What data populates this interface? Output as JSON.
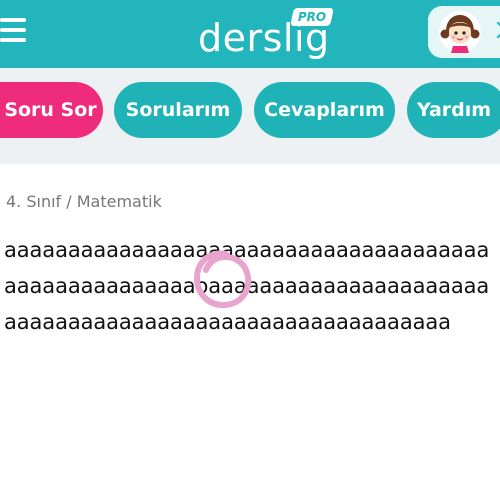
{
  "header": {
    "logo_text": "derslig",
    "logo_badge": "PRO",
    "menu_icon": "hamburger-menu-icon",
    "avatar_icon": "girl-avatar-icon",
    "colors": {
      "teal": "#22b5bb",
      "white": "#ffffff"
    }
  },
  "nav": {
    "items": [
      {
        "label": "Soru Sor",
        "active": true
      },
      {
        "label": "Sorularım",
        "active": false
      },
      {
        "label": "Cevaplarım",
        "active": false
      },
      {
        "label": "Yardım",
        "active": false
      }
    ],
    "colors": {
      "active": "#ef2b7b",
      "inactive": "#1fb3b8",
      "band": "#eef1f3"
    }
  },
  "question": {
    "breadcrumb": "4. Sınıf / Matematik",
    "lines": [
      "aaaaaaaaaaaaaaaaaaaaaaaaaaaaaaaaaaaaaa",
      "aaaaaaaaaaaaaaaoaaaaaaaaaaaaaaaaaaaaaa",
      "aaaaaaaaaaaaaaaaaaaaaaaaaaaaaaaaaaa"
    ],
    "annotation_color": "#e9a3cf"
  }
}
